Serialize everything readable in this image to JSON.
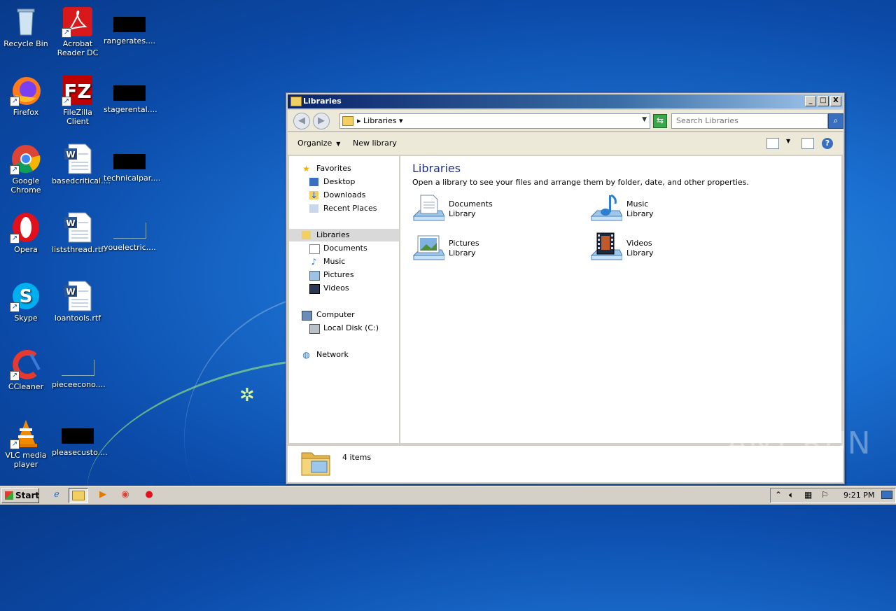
{
  "desktop": {
    "icons": [
      {
        "label": "Recycle Bin"
      },
      {
        "label": "Acrobat Reader DC"
      },
      {
        "label": "rangerates...."
      },
      {
        "label": "Firefox"
      },
      {
        "label": "FileZilla Client"
      },
      {
        "label": "stagerental...."
      },
      {
        "label": "Google Chrome"
      },
      {
        "label": "basedcritical...."
      },
      {
        "label": "technicalpar...."
      },
      {
        "label": "Opera"
      },
      {
        "label": "liststhread.rtf"
      },
      {
        "label": "youelectric...."
      },
      {
        "label": "Skype"
      },
      {
        "label": "loantools.rtf"
      },
      {
        "label": "CCleaner"
      },
      {
        "label": "pieceecono...."
      },
      {
        "label": "VLC media player"
      },
      {
        "label": "pleasecusto...."
      }
    ],
    "watermark": "ANY RUN"
  },
  "window": {
    "title": "Libraries",
    "controls": {
      "minimize": "_",
      "maximize": "□",
      "close": "X"
    },
    "address": {
      "crumb": "Libraries"
    },
    "search": {
      "placeholder": "Search Libraries"
    },
    "toolbar": {
      "organize": "Organize",
      "new_library": "New library"
    },
    "nav": {
      "favorites": "Favorites",
      "desktop": "Desktop",
      "downloads": "Downloads",
      "recent_places": "Recent Places",
      "libraries": "Libraries",
      "documents": "Documents",
      "music": "Music",
      "pictures": "Pictures",
      "videos": "Videos",
      "computer": "Computer",
      "local_disk": "Local Disk (C:)",
      "network": "Network"
    },
    "content": {
      "title": "Libraries",
      "subtitle": "Open a library to see your files and arrange them by folder, date, and other properties.",
      "libraries": [
        {
          "name": "Documents",
          "type": "Library"
        },
        {
          "name": "Music",
          "type": "Library"
        },
        {
          "name": "Pictures",
          "type": "Library"
        },
        {
          "name": "Videos",
          "type": "Library"
        }
      ]
    },
    "details": {
      "count": "4 items"
    }
  },
  "taskbar": {
    "start_label": "Start",
    "clock": "9:21 PM"
  }
}
